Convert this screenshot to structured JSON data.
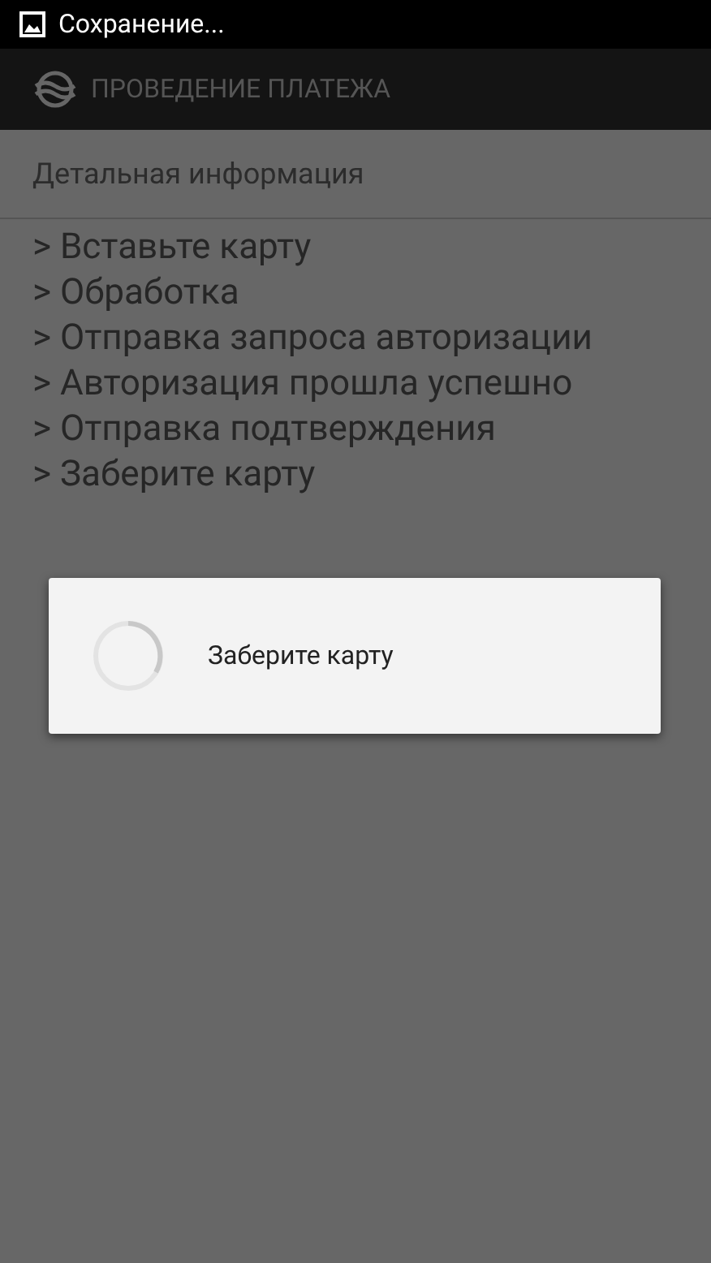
{
  "status_bar": {
    "notification": "Сохранение..."
  },
  "action_bar": {
    "title": "ПРОВЕДЕНИЕ ПЛАТЕЖА"
  },
  "section": {
    "title": "Детальная информация"
  },
  "log": [
    "> Вставьте карту",
    "> Обработка",
    "> Отправка запроса авторизации",
    "> Авторизация прошла успешно",
    "> Отправка подтверждения",
    "> Заберите карту"
  ],
  "dialog": {
    "message": "Заберите карту"
  }
}
